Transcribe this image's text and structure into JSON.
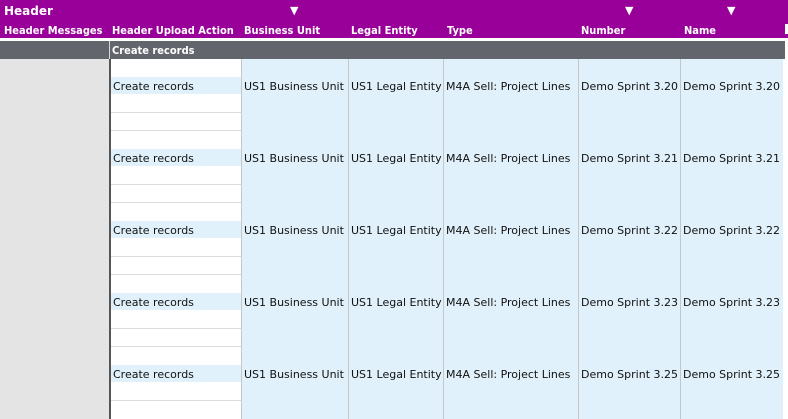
{
  "header": {
    "title": "Header",
    "filter_glyph": "▼",
    "columns": [
      "Header Messages",
      "Header Upload Action",
      "Business Unit",
      "Legal Entity",
      "Type",
      "Number",
      "Name"
    ]
  },
  "group_label": "Create records",
  "rows": [
    {
      "action": "Create records",
      "business_unit": "US1 Business Unit",
      "legal_entity": "US1 Legal Entity",
      "type": "M4A Sell: Project Lines",
      "number": "Demo Sprint 3.20",
      "name": "Demo Sprint 3.20"
    },
    {
      "action": "Create records",
      "business_unit": "US1 Business Unit",
      "legal_entity": "US1 Legal Entity",
      "type": "M4A Sell: Project Lines",
      "number": "Demo Sprint 3.21",
      "name": "Demo Sprint 3.21"
    },
    {
      "action": "Create records",
      "business_unit": "US1 Business Unit",
      "legal_entity": "US1 Legal Entity",
      "type": "M4A Sell: Project Lines",
      "number": "Demo Sprint 3.22",
      "name": "Demo Sprint 3.22"
    },
    {
      "action": "Create records",
      "business_unit": "US1 Business Unit",
      "legal_entity": "US1 Legal Entity",
      "type": "M4A Sell: Project Lines",
      "number": "Demo Sprint 3.23",
      "name": "Demo Sprint 3.23"
    },
    {
      "action": "Create records",
      "business_unit": "US1 Business Unit",
      "legal_entity": "US1 Legal Entity",
      "type": "M4A Sell: Project Lines",
      "number": "Demo Sprint 3.25",
      "name": "Demo Sprint 3.25"
    }
  ],
  "colors": {
    "header_bg": "#990099",
    "group_bg": "#62666c",
    "message_col_bg": "#e4e4e4",
    "input_cell_bg": "#e1f1fb"
  }
}
